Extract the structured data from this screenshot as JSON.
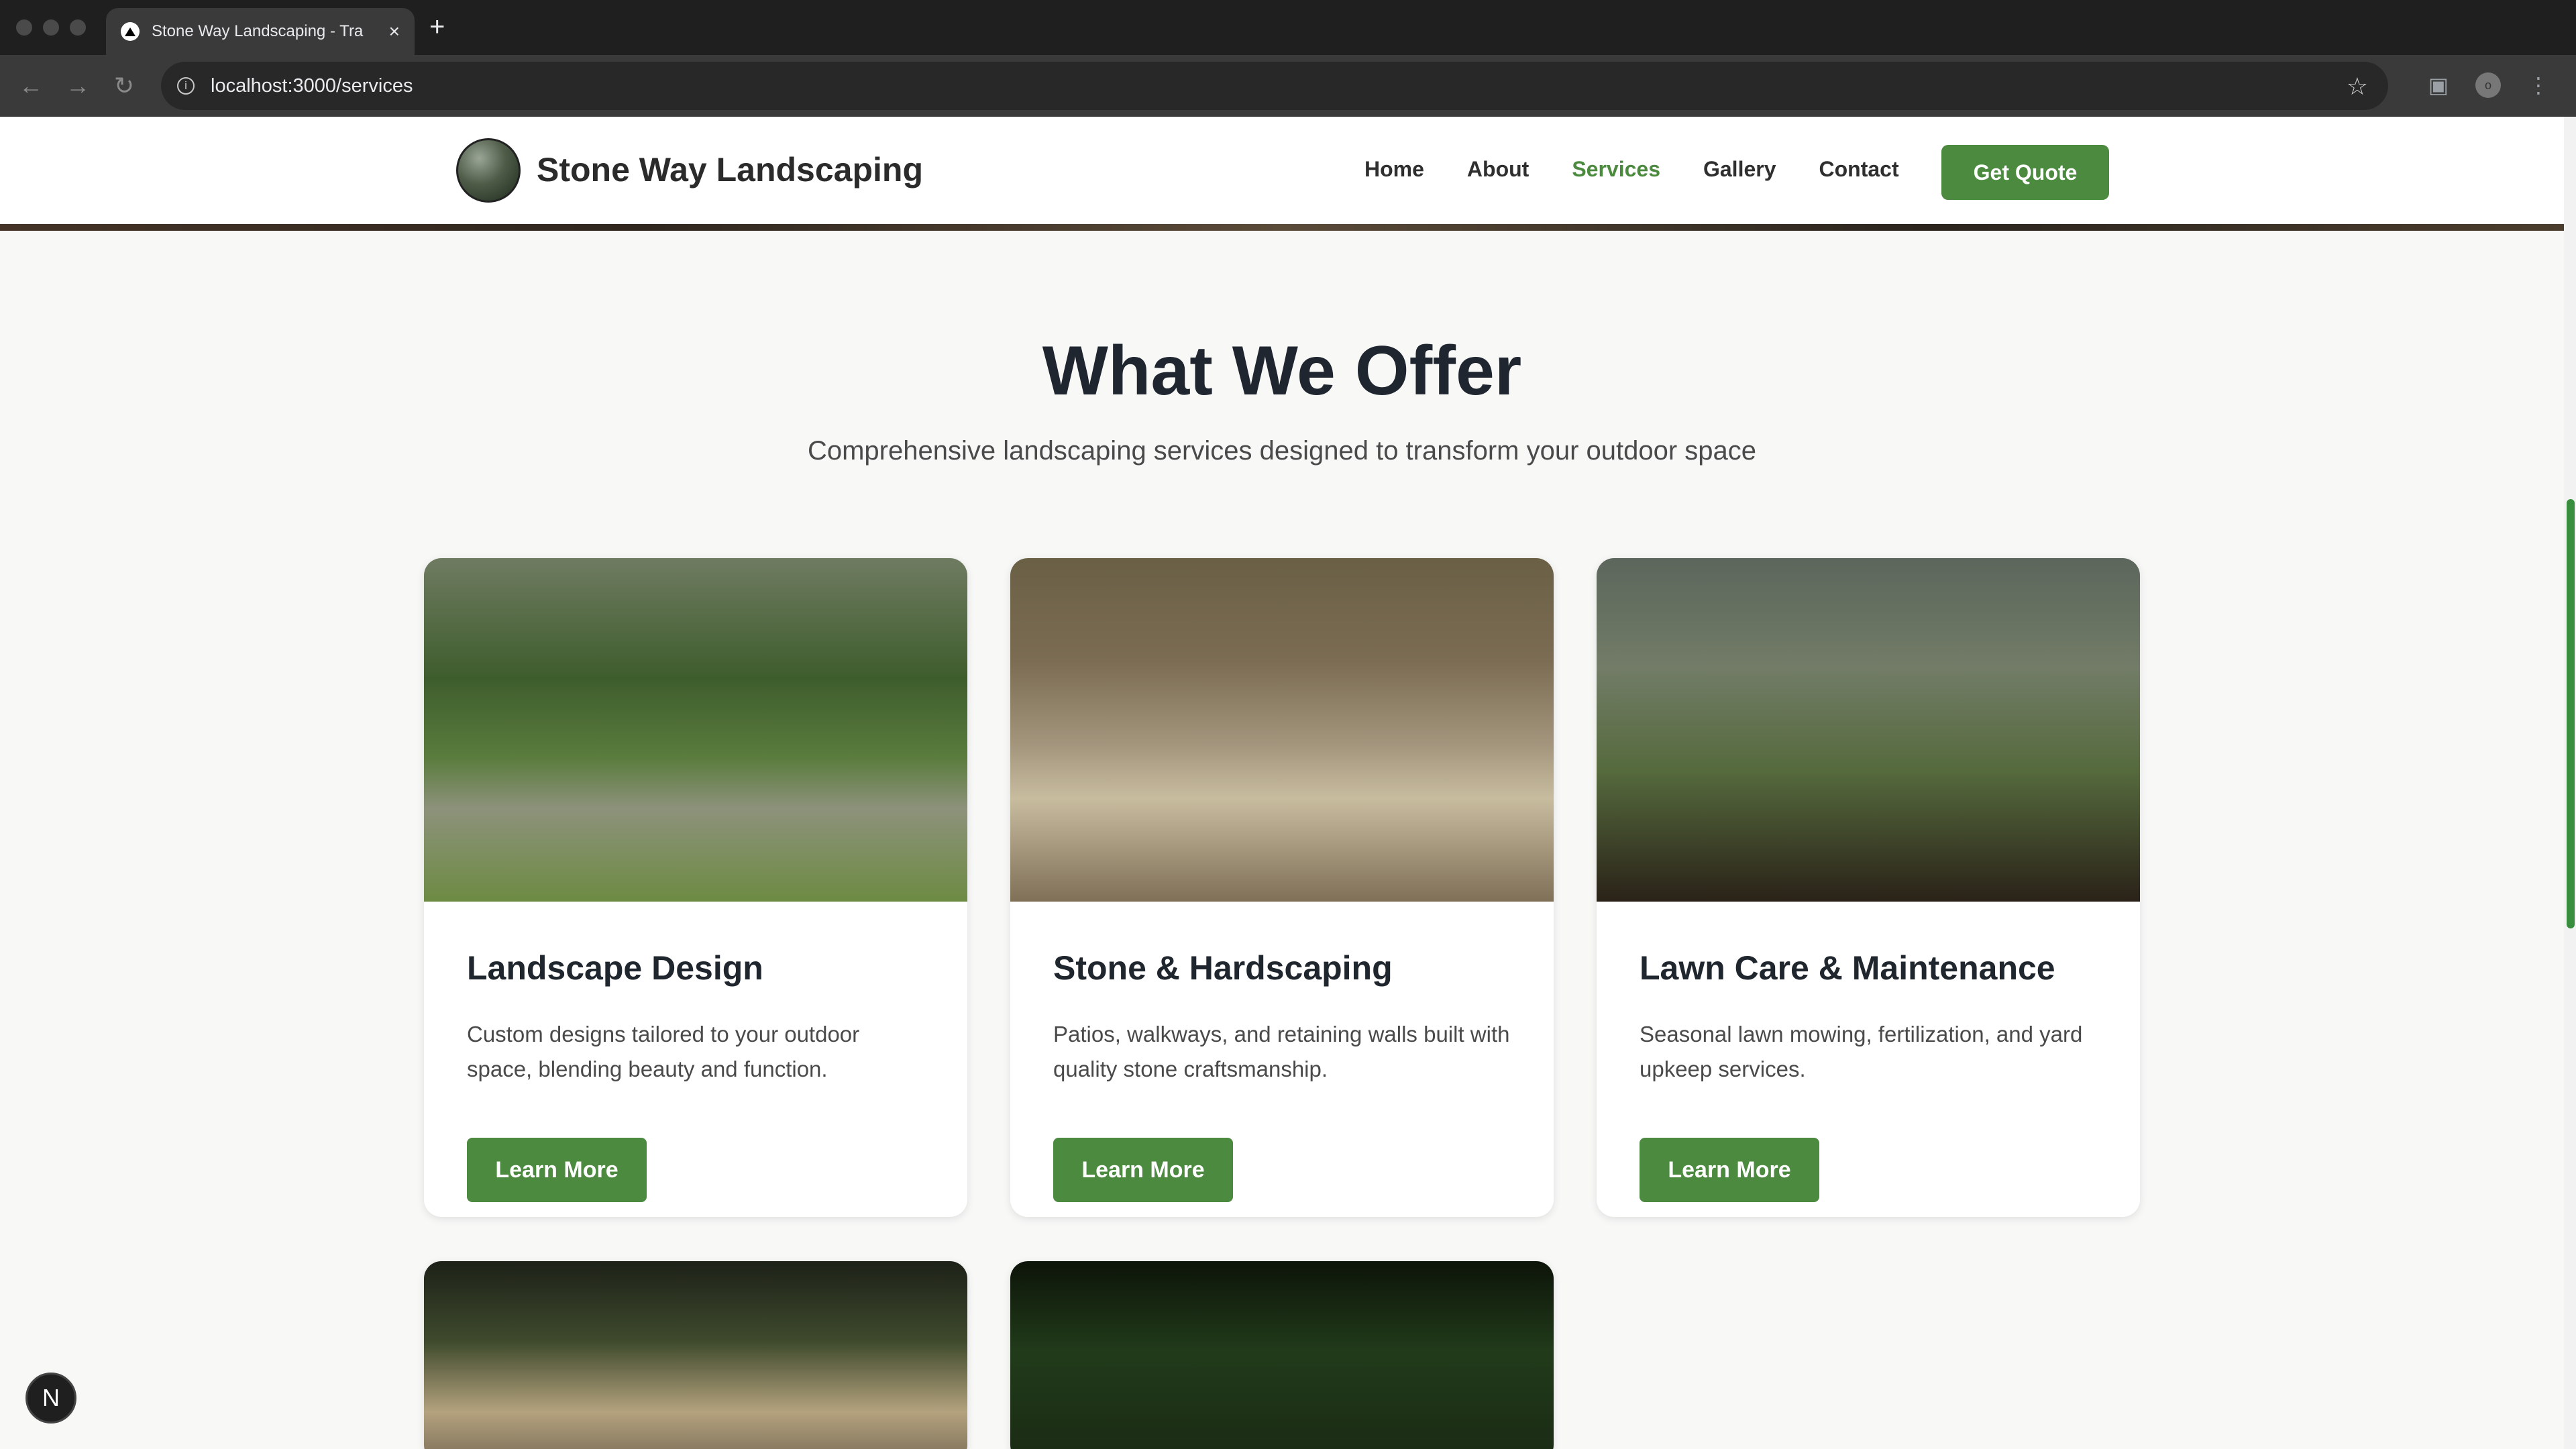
{
  "browser": {
    "tab_title": "Stone Way Landscaping - Tra",
    "url": "localhost:3000/services",
    "new_tab": "+",
    "close": "×",
    "back": "←",
    "forward": "→",
    "reload": "↻",
    "star": "☆",
    "avatar": "o"
  },
  "header": {
    "brand": "Stone Way Landscaping",
    "nav": [
      "Home",
      "About",
      "Services",
      "Gallery",
      "Contact"
    ],
    "active_nav": "Services",
    "cta": "Get Quote"
  },
  "hero": {
    "title": "What We Offer",
    "subtitle": "Comprehensive landscaping services designed to transform your outdoor space"
  },
  "cards": [
    {
      "title": "Landscape Design",
      "description": "Custom designs tailored to your outdoor space, blending beauty and function.",
      "button": "Learn More"
    },
    {
      "title": "Stone & Hardscaping",
      "description": "Patios, walkways, and retaining walls built with quality stone craftsmanship.",
      "button": "Learn More"
    },
    {
      "title": "Lawn Care & Maintenance",
      "description": "Seasonal lawn mowing, fertilization, and yard upkeep services.",
      "button": "Learn More"
    }
  ],
  "badge": "N",
  "colors": {
    "primary": "#4c8b3f",
    "text": "#1f2630",
    "background": "#f8f8f7"
  }
}
